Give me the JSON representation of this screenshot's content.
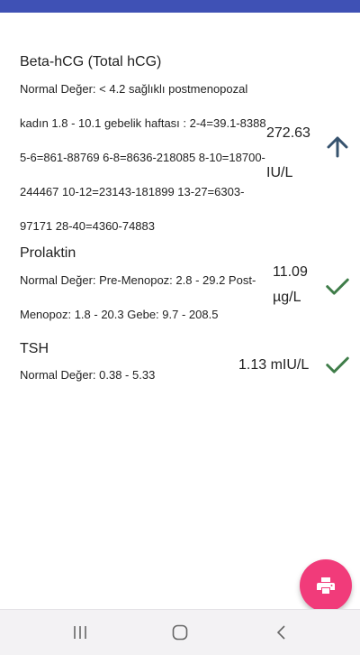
{
  "tests": [
    {
      "name": "Beta-hCG (Total hCG)",
      "normal": "Normal Değer: < 4.2 sağlıklı postmenopozal kadın 1.8 - 10.1 gebelik haftası : 2-4=39.1-8388 5-6=861-88769 6-8=8636-218085 8-10=18700-244467 10-12=23143-181899 13-27=6303-97171 28-40=4360-74883",
      "value": "272.63",
      "unit": "IU/L",
      "status_icon": "arrow-up-icon",
      "status_color": "#37536e"
    },
    {
      "name": "Prolaktin",
      "normal": "Normal Değer: Pre-Menopoz: 2.8 - 29.2 Post-Menopoz: 1.8 - 20.3 Gebe: 9.7 - 208.5",
      "value": "11.09",
      "unit": "µg/L",
      "status_icon": "check-icon",
      "status_color": "#3f7d49"
    },
    {
      "name": "TSH",
      "normal": "Normal Değer: 0.38 - 5.33",
      "value": "1.13 mIU/L",
      "unit": "",
      "status_icon": "check-icon",
      "status_color": "#3f7d49"
    }
  ],
  "fab": {
    "icon": "print-icon",
    "color": "#f13b7a"
  },
  "nav": {
    "icons": [
      "recent-apps-icon",
      "home-icon",
      "back-icon"
    ]
  },
  "colors": {
    "status_bar": "#3f51b5"
  }
}
